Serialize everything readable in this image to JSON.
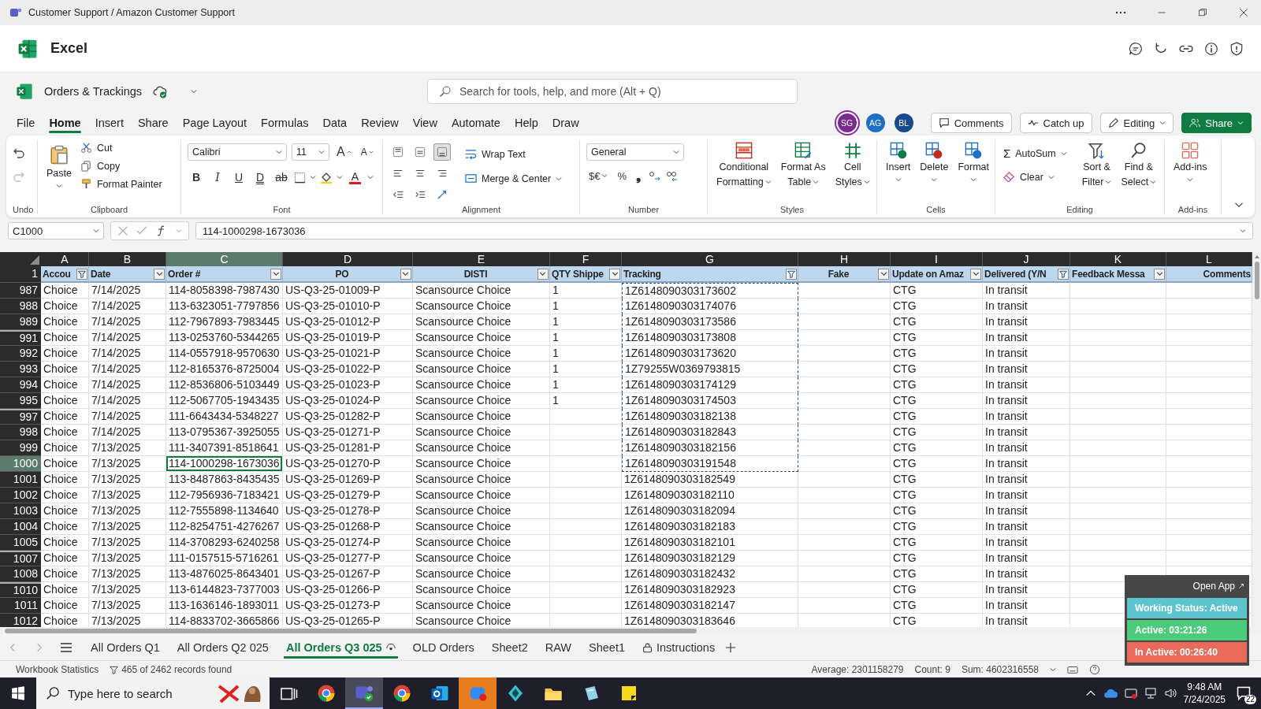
{
  "window": {
    "title": "Customer Support / Amazon Customer Support"
  },
  "app": {
    "name": "Excel"
  },
  "document": {
    "name": "Orders & Trackings",
    "saved": true
  },
  "search": {
    "placeholder": "Search for tools, help, and more (Alt + Q)"
  },
  "menu_tabs": [
    {
      "label": "File",
      "selected": false
    },
    {
      "label": "Home",
      "selected": true
    },
    {
      "label": "Insert",
      "selected": false
    },
    {
      "label": "Share",
      "selected": false
    },
    {
      "label": "Page Layout",
      "selected": false
    },
    {
      "label": "Formulas",
      "selected": false
    },
    {
      "label": "Data",
      "selected": false
    },
    {
      "label": "Review",
      "selected": false
    },
    {
      "label": "View",
      "selected": false
    },
    {
      "label": "Automate",
      "selected": false
    },
    {
      "label": "Help",
      "selected": false
    },
    {
      "label": "Draw",
      "selected": false
    }
  ],
  "collaborators": [
    {
      "initials": "SG",
      "color": "#7b2a8e",
      "highlighted": true
    },
    {
      "initials": "AG",
      "color": "#1f6fc5",
      "highlighted": false
    },
    {
      "initials": "BL",
      "color": "#1b4a8a",
      "highlighted": false
    }
  ],
  "header_buttons": [
    {
      "label": "Comments",
      "kind": "comments"
    },
    {
      "label": "Catch up",
      "kind": "catch-up"
    },
    {
      "label": "Editing",
      "kind": "editing"
    },
    {
      "label": "Share",
      "kind": "share"
    }
  ],
  "ribbon": {
    "groups": [
      {
        "kind": "undo",
        "label": "Undo",
        "buttons": [
          {
            "disabled": false
          },
          {
            "disabled": true
          }
        ]
      },
      {
        "kind": "clipboard",
        "label": "Clipboard",
        "paste": "Paste",
        "actions": [
          "Cut",
          "Copy",
          "Format Painter"
        ]
      },
      {
        "kind": "font",
        "label": "Font",
        "font": "Calibri",
        "size": "11",
        "resize": [
          "A",
          "A"
        ],
        "styles": [
          "B",
          "I",
          "U",
          "D",
          "ab"
        ],
        "color_letter": "A"
      },
      {
        "kind": "alignment",
        "label": "Alignment",
        "vertical": [
          {
            "selected": false
          },
          {
            "selected": false
          },
          {
            "selected": true
          }
        ],
        "wrap": "Wrap Text",
        "merge": "Merge & Center"
      },
      {
        "kind": "number",
        "label": "Number",
        "format": "General",
        "symbols": [
          "$€",
          "%",
          "❟"
        ]
      },
      {
        "kind": "styles",
        "label": "Styles",
        "buttons": [
          {
            "lines": [
              "Conditional",
              "Formatting"
            ]
          },
          {
            "lines": [
              "Format As",
              "Table"
            ]
          },
          {
            "lines": [
              "Cell",
              "Styles"
            ]
          }
        ]
      },
      {
        "kind": "cells",
        "label": "Cells",
        "buttons": [
          "Insert",
          "Delete",
          "Format"
        ]
      },
      {
        "kind": "editing",
        "label": "Editing",
        "symbol": "Σ",
        "autosum": "AutoSum",
        "clear": "Clear",
        "buttons": [
          {
            "lines": [
              "Sort &",
              "Filter"
            ]
          },
          {
            "lines": [
              "Find &",
              "Select"
            ]
          }
        ]
      },
      {
        "kind": "addins",
        "label": "Add-ins",
        "button": "Add-ins"
      }
    ]
  },
  "formula_bar": {
    "name_box": "C1000",
    "formula": "114-1000298-1673036"
  },
  "sheet": {
    "columns": [
      {
        "letter": "A",
        "selected": false
      },
      {
        "letter": "B",
        "selected": false
      },
      {
        "letter": "C",
        "selected": true
      },
      {
        "letter": "D",
        "selected": false
      },
      {
        "letter": "E",
        "selected": false
      },
      {
        "letter": "F",
        "selected": false
      },
      {
        "letter": "G",
        "selected": false
      },
      {
        "letter": "H",
        "selected": false
      },
      {
        "letter": "I",
        "selected": false
      },
      {
        "letter": "J",
        "selected": false
      },
      {
        "letter": "K",
        "selected": false
      },
      {
        "letter": "L",
        "selected": false
      }
    ],
    "header_row": "1",
    "headers": [
      {
        "label": "Accou",
        "filtered": true
      },
      {
        "label": "Date",
        "filtered": false
      },
      {
        "label": "Order #",
        "filtered": false
      },
      {
        "label": "PO",
        "filtered": false
      },
      {
        "label": "DISTI",
        "filtered": false
      },
      {
        "label": "QTY Shippe",
        "filtered": false
      },
      {
        "label": "Tracking",
        "filtered": true
      },
      {
        "label": "Fake",
        "filtered": false
      },
      {
        "label": "Update on Amaz",
        "filtered": false
      },
      {
        "label": "Delivered (Y/N",
        "filtered": true
      },
      {
        "label": "Feedback Messa",
        "filtered": false
      },
      {
        "label": "Comments"
      }
    ],
    "rows": [
      {
        "row": "987",
        "hidden_before": false,
        "selected": false,
        "copied": true,
        "cells": {
          "A": "Choice",
          "B": "7/14/2025",
          "C": "114-8058398-7987430",
          "D": "US-Q3-25-01009-P",
          "E": "Scansource Choice",
          "F": "1",
          "G": "1Z6148090303173602",
          "I": "CTG",
          "J": "In transit"
        }
      },
      {
        "row": "988",
        "hidden_before": false,
        "selected": false,
        "copied": true,
        "cells": {
          "A": "Choice",
          "B": "7/14/2025",
          "C": "113-6323051-7797856",
          "D": "US-Q3-25-01010-P",
          "E": "Scansource Choice",
          "F": "1",
          "G": "1Z6148090303174076",
          "I": "CTG",
          "J": "In transit"
        }
      },
      {
        "row": "989",
        "hidden_before": false,
        "selected": false,
        "copied": true,
        "cells": {
          "A": "Choice",
          "B": "7/14/2025",
          "C": "112-7967893-7983445",
          "D": "US-Q3-25-01012-P",
          "E": "Scansource Choice",
          "F": "1",
          "G": "1Z6148090303173586",
          "I": "CTG",
          "J": "In transit"
        }
      },
      {
        "row": "991",
        "hidden_before": true,
        "selected": false,
        "copied": true,
        "cells": {
          "A": "Choice",
          "B": "7/14/2025",
          "C": "113-0253760-5344265",
          "D": "US-Q3-25-01019-P",
          "E": "Scansource Choice",
          "F": "1",
          "G": "1Z6148090303173808",
          "I": "CTG",
          "J": "In transit"
        }
      },
      {
        "row": "992",
        "hidden_before": false,
        "selected": false,
        "copied": true,
        "cells": {
          "A": "Choice",
          "B": "7/14/2025",
          "C": "114-0557918-9570630",
          "D": "US-Q3-25-01021-P",
          "E": "Scansource Choice",
          "F": "1",
          "G": "1Z6148090303173620",
          "I": "CTG",
          "J": "In transit"
        }
      },
      {
        "row": "993",
        "hidden_before": false,
        "selected": false,
        "copied": true,
        "cells": {
          "A": "Choice",
          "B": "7/14/2025",
          "C": "112-8165376-8725004",
          "D": "US-Q3-25-01022-P",
          "E": "Scansource Choice",
          "F": "1",
          "G": "1Z79255W0369793815",
          "I": "CTG",
          "J": "In transit"
        }
      },
      {
        "row": "994",
        "hidden_before": false,
        "selected": false,
        "copied": true,
        "cells": {
          "A": "Choice",
          "B": "7/14/2025",
          "C": "112-8536806-5103449",
          "D": "US-Q3-25-01023-P",
          "E": "Scansource Choice",
          "F": "1",
          "G": "1Z6148090303174129",
          "I": "CTG",
          "J": "In transit"
        }
      },
      {
        "row": "995",
        "hidden_before": false,
        "selected": false,
        "copied": true,
        "cells": {
          "A": "Choice",
          "B": "7/14/2025",
          "C": "112-5067705-1943435",
          "D": "US-Q3-25-01024-P",
          "E": "Scansource Choice",
          "F": "1",
          "G": "1Z6148090303174503",
          "I": "CTG",
          "J": "In transit"
        }
      },
      {
        "row": "997",
        "hidden_before": true,
        "selected": false,
        "copied": true,
        "cells": {
          "A": "Choice",
          "B": "7/14/2025",
          "C": "111-6643434-5348227",
          "D": "US-Q3-25-01282-P",
          "E": "Scansource Choice",
          "G": "1Z6148090303182138",
          "I": "CTG",
          "J": "In transit"
        }
      },
      {
        "row": "998",
        "hidden_before": false,
        "selected": false,
        "copied": true,
        "cells": {
          "A": "Choice",
          "B": "7/14/2025",
          "C": "113-0795367-3925055",
          "D": "US-Q3-25-01271-P",
          "E": "Scansource Choice",
          "G": "1Z6148090303182843",
          "I": "CTG",
          "J": "In transit"
        }
      },
      {
        "row": "999",
        "hidden_before": false,
        "selected": false,
        "copied": true,
        "cells": {
          "A": "Choice",
          "B": "7/13/2025",
          "C": "111-3407391-8518641",
          "D": "US-Q3-25-01281-P",
          "E": "Scansource Choice",
          "G": "1Z6148090303182156",
          "I": "CTG",
          "J": "In transit"
        }
      },
      {
        "row": "1000",
        "hidden_before": false,
        "selected": true,
        "copied": true,
        "cells": {
          "A": "Choice",
          "B": "7/13/2025",
          "C": "114-1000298-1673036",
          "D": "US-Q3-25-01270-P",
          "E": "Scansource Choice",
          "G": "1Z6148090303191548",
          "I": "CTG",
          "J": "In transit"
        }
      },
      {
        "row": "1001",
        "hidden_before": false,
        "selected": false,
        "copied": false,
        "cells": {
          "A": "Choice",
          "B": "7/13/2025",
          "C": "113-8487863-8435435",
          "D": "US-Q3-25-01269-P",
          "E": "Scansource Choice",
          "G": "1Z6148090303182549",
          "I": "CTG",
          "J": "In transit"
        }
      },
      {
        "row": "1002",
        "hidden_before": false,
        "selected": false,
        "copied": false,
        "cells": {
          "A": "Choice",
          "B": "7/13/2025",
          "C": "112-7956936-7183421",
          "D": "US-Q3-25-01279-P",
          "E": "Scansource Choice",
          "G": "1Z6148090303182110",
          "I": "CTG",
          "J": "In transit"
        }
      },
      {
        "row": "1003",
        "hidden_before": false,
        "selected": false,
        "copied": false,
        "cells": {
          "A": "Choice",
          "B": "7/13/2025",
          "C": "112-7555898-1134640",
          "D": "US-Q3-25-01278-P",
          "E": "Scansource Choice",
          "G": "1Z6148090303182094",
          "I": "CTG",
          "J": "In transit"
        }
      },
      {
        "row": "1004",
        "hidden_before": false,
        "selected": false,
        "copied": false,
        "cells": {
          "A": "Choice",
          "B": "7/13/2025",
          "C": "112-8254751-4276267",
          "D": "US-Q3-25-01268-P",
          "E": "Scansource Choice",
          "G": "1Z6148090303182183",
          "I": "CTG",
          "J": "In transit"
        }
      },
      {
        "row": "1005",
        "hidden_before": false,
        "selected": false,
        "copied": false,
        "cells": {
          "A": "Choice",
          "B": "7/13/2025",
          "C": "114-3708293-6240258",
          "D": "US-Q3-25-01274-P",
          "E": "Scansource Choice",
          "G": "1Z6148090303182101",
          "I": "CTG",
          "J": "In transit"
        }
      },
      {
        "row": "1007",
        "hidden_before": true,
        "selected": false,
        "copied": false,
        "cells": {
          "A": "Choice",
          "B": "7/13/2025",
          "C": "111-0157515-5716261",
          "D": "US-Q3-25-01277-P",
          "E": "Scansource Choice",
          "G": "1Z6148090303182129",
          "I": "CTG",
          "J": "In transit"
        }
      },
      {
        "row": "1008",
        "hidden_before": false,
        "selected": false,
        "copied": false,
        "cells": {
          "A": "Choice",
          "B": "7/13/2025",
          "C": "113-4876025-8643401",
          "D": "US-Q3-25-01267-P",
          "E": "Scansource Choice",
          "G": "1Z6148090303182432",
          "I": "CTG",
          "J": "In transit"
        }
      },
      {
        "row": "1010",
        "hidden_before": true,
        "selected": false,
        "copied": false,
        "cells": {
          "A": "Choice",
          "B": "7/13/2025",
          "C": "113-6144823-7377003",
          "D": "US-Q3-25-01266-P",
          "E": "Scansource Choice",
          "G": "1Z6148090303182923",
          "I": "CTG",
          "J": "In transit"
        }
      },
      {
        "row": "1011",
        "hidden_before": false,
        "selected": false,
        "copied": false,
        "cells": {
          "A": "Choice",
          "B": "7/13/2025",
          "C": "113-1636146-1893011",
          "D": "US-Q3-25-01273-P",
          "E": "Scansource Choice",
          "G": "1Z6148090303182147",
          "I": "CTG",
          "J": "In transit"
        }
      },
      {
        "row": "1012",
        "hidden_before": false,
        "selected": false,
        "copied": false,
        "cells": {
          "A": "Choice",
          "B": "7/13/2025",
          "C": "114-8833702-3665866",
          "D": "US-Q3-25-01265-P",
          "E": "Scansource Choice",
          "G": "1Z6148090303183646",
          "I": "CTG",
          "J": "In transit"
        }
      }
    ]
  },
  "sheet_tabs": [
    {
      "label": "All Orders Q1",
      "kind": "plain",
      "selected": false
    },
    {
      "label": "All Orders Q2 025",
      "kind": "plain",
      "selected": false
    },
    {
      "label": "All Orders Q3 025",
      "kind": "watched",
      "selected": true
    },
    {
      "label": "OLD Orders",
      "kind": "plain",
      "selected": false
    },
    {
      "label": "Sheet2",
      "kind": "plain",
      "selected": false
    },
    {
      "label": "RAW",
      "kind": "plain",
      "selected": false
    },
    {
      "label": "Sheet1",
      "kind": "plain",
      "selected": false
    },
    {
      "label": "Instructions",
      "kind": "locked",
      "selected": false
    }
  ],
  "status_bar": {
    "statistics": "Workbook Statistics",
    "filter_result": "465 of 2462 records found",
    "average": "Average: 2301158279",
    "count": "Count: 9",
    "sum": "Sum: 4602316558"
  },
  "tracker": {
    "open_label": "Open App",
    "items": [
      {
        "label": "Working Status: Active",
        "color": "#5cc4cc"
      },
      {
        "label": "Active: 03:21:26",
        "color": "#4ccb7b"
      },
      {
        "label": "In Active: 00:26:40",
        "color": "#e9695b"
      }
    ]
  },
  "taskbar": {
    "search_placeholder": "Type here to search",
    "apps": [
      {
        "kind": "task-view",
        "selected": false,
        "flashing": false
      },
      {
        "kind": "browser",
        "selected": false,
        "flashing": false
      },
      {
        "kind": "chat",
        "selected": true,
        "flashing": false
      },
      {
        "kind": "browser",
        "selected": false,
        "flashing": false
      },
      {
        "kind": "mail",
        "selected": false,
        "flashing": false
      },
      {
        "kind": "meeting",
        "selected": false,
        "flashing": true
      },
      {
        "kind": "diamond",
        "selected": false,
        "flashing": false
      },
      {
        "kind": "folder",
        "selected": false,
        "flashing": false
      },
      {
        "kind": "notes",
        "selected": false,
        "flashing": false
      },
      {
        "kind": "sticky",
        "selected": false,
        "flashing": false
      }
    ],
    "time": "9:48 AM",
    "date": "7/24/2025",
    "notifications": "22"
  }
}
